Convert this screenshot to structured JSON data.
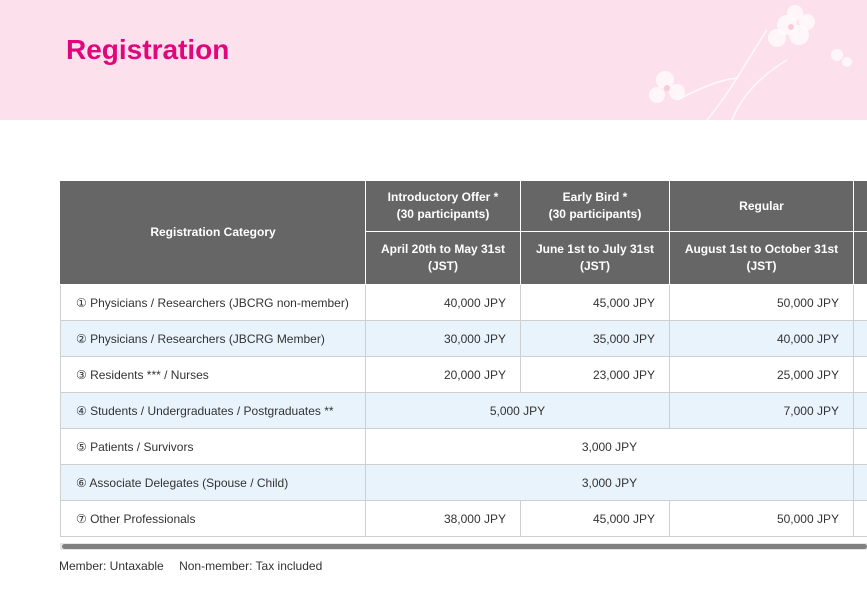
{
  "header": {
    "title": "Registration"
  },
  "table": {
    "header_top": {
      "category": "Registration Category",
      "introductory": "Introductory Offer *\n(30 participants)",
      "early_bird": "Early Bird *\n(30 participants)",
      "regular": "Regular"
    },
    "header_dates": {
      "introductory": "April 20th to May 31st\n(JST)",
      "early_bird": "June 1st to July 31st\n(JST)",
      "regular": "August 1st to October 31st\n(JST)"
    },
    "rows": [
      {
        "category": "① Physicians / Researchers (JBCRG non-member)",
        "introductory": "40,000 JPY",
        "early_bird": "45,000 JPY",
        "regular": "50,000 JPY"
      },
      {
        "category": "② Physicians / Researchers (JBCRG Member)",
        "introductory": "30,000 JPY",
        "early_bird": "35,000 JPY",
        "regular": "40,000 JPY"
      },
      {
        "category": "③ Residents *** / Nurses",
        "introductory": "20,000 JPY",
        "early_bird": "23,000 JPY",
        "regular": "25,000 JPY"
      },
      {
        "category": "④ Students / Undergraduates / Postgraduates **",
        "intro_early": "5,000 JPY",
        "regular": "7,000 JPY"
      },
      {
        "category": "⑤ Patients / Survivors",
        "all": "3,000 JPY"
      },
      {
        "category": "⑥ Associate Delegates (Spouse / Child)",
        "all": "3,000 JPY"
      },
      {
        "category": "⑦ Other Professionals",
        "introductory": "38,000 JPY",
        "early_bird": "45,000 JPY",
        "regular": "50,000 JPY"
      }
    ]
  },
  "footnote": {
    "member": "Member: Untaxable",
    "non_member": "Non-member: Tax included"
  },
  "colors": {
    "header_bg": "#fce1ec",
    "title": "#e0077d",
    "table_header_bg": "#666666",
    "alt_row_bg": "#e9f3fc"
  },
  "icons": {
    "header_decoration": "flower-decoration-icon"
  }
}
